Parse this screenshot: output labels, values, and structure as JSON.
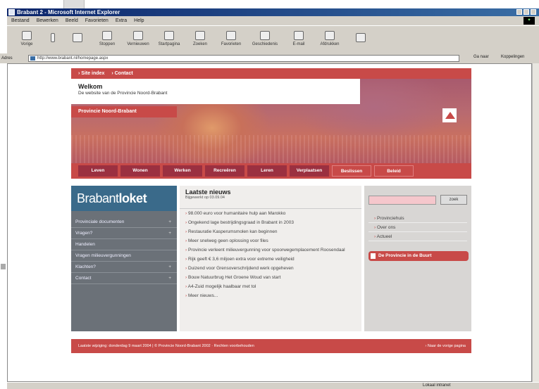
{
  "window": {
    "title": "Brabant 2 - Microsoft Internet Explorer"
  },
  "menu": [
    "Bestand",
    "Bewerken",
    "Beeld",
    "Favorieten",
    "Extra",
    "Help"
  ],
  "toolbar": {
    "buttons": [
      "Vorige",
      "",
      "",
      "Stoppen",
      "Vernieuwen",
      "Startpagina",
      "Zoeken",
      "Favorieten",
      "Geschiedenis",
      "E-mail",
      "Afdrukken",
      ""
    ]
  },
  "address": {
    "label": "Adres",
    "url": "http://www.brabant.nl/homepage.aspx",
    "go": "Ga naar",
    "links": "Koppelingen"
  },
  "site": {
    "topnav": [
      "› Site index",
      "› Contact"
    ],
    "welcome_title": "Welkom",
    "welcome_sub": "De website van de Provincie Noord-Brabant",
    "province_label": "Provincie Noord-Brabant",
    "mainnav": [
      "Leven",
      "Wonen",
      "Werken",
      "Recreëren",
      "Leren",
      "Verplaatsen",
      "Beslissen",
      "Beleid"
    ],
    "loket": {
      "logo_light": "Brabant",
      "logo_bold": "loket",
      "items": [
        "Provinciale documenten",
        "Vragen?",
        "Handelen",
        "Vragen milieuvergunningen",
        "Klachten?",
        "Contact"
      ]
    },
    "news": {
      "title": "Laatste nieuws",
      "date": "Bijgewerkt op 03.09.04",
      "items": [
        "98.000 euro voor humanitaire hulp aan Marokko",
        "Ongekend lage bestrijdingsgraad in Brabant in 2003",
        "Restauratie Kasperumsmolen kan beginnen",
        "Meer snelweg geen oplossing voor files",
        "Provincie verleent milieuvergunning voor spoorwegemplacement Roosendaal",
        "Rijk geeft € 3,6 miljoen extra voor extreme veiligheid",
        "Duizend voor Grensoverschrijdend werk opgeheven",
        "Bouw Natuurbrug Het Groene Woud van start",
        "A4-Zuid mogelijk haalbaar met tol",
        "Meer nieuws..."
      ]
    },
    "right": {
      "search_button": "zoek",
      "links": [
        "Provinciehuis",
        "Over ons",
        "Actueel"
      ],
      "buurt": "De Provincie in de Buurt"
    },
    "footer": {
      "left": "Laatste wijziging: donderdag 9 maart 2004 | © Provincie Noord-Brabant 2002  ·  Rechten voorbehouden",
      "right": "› Naar de vorige pagina"
    }
  },
  "status": {
    "zone": "Lokaal intranet"
  }
}
